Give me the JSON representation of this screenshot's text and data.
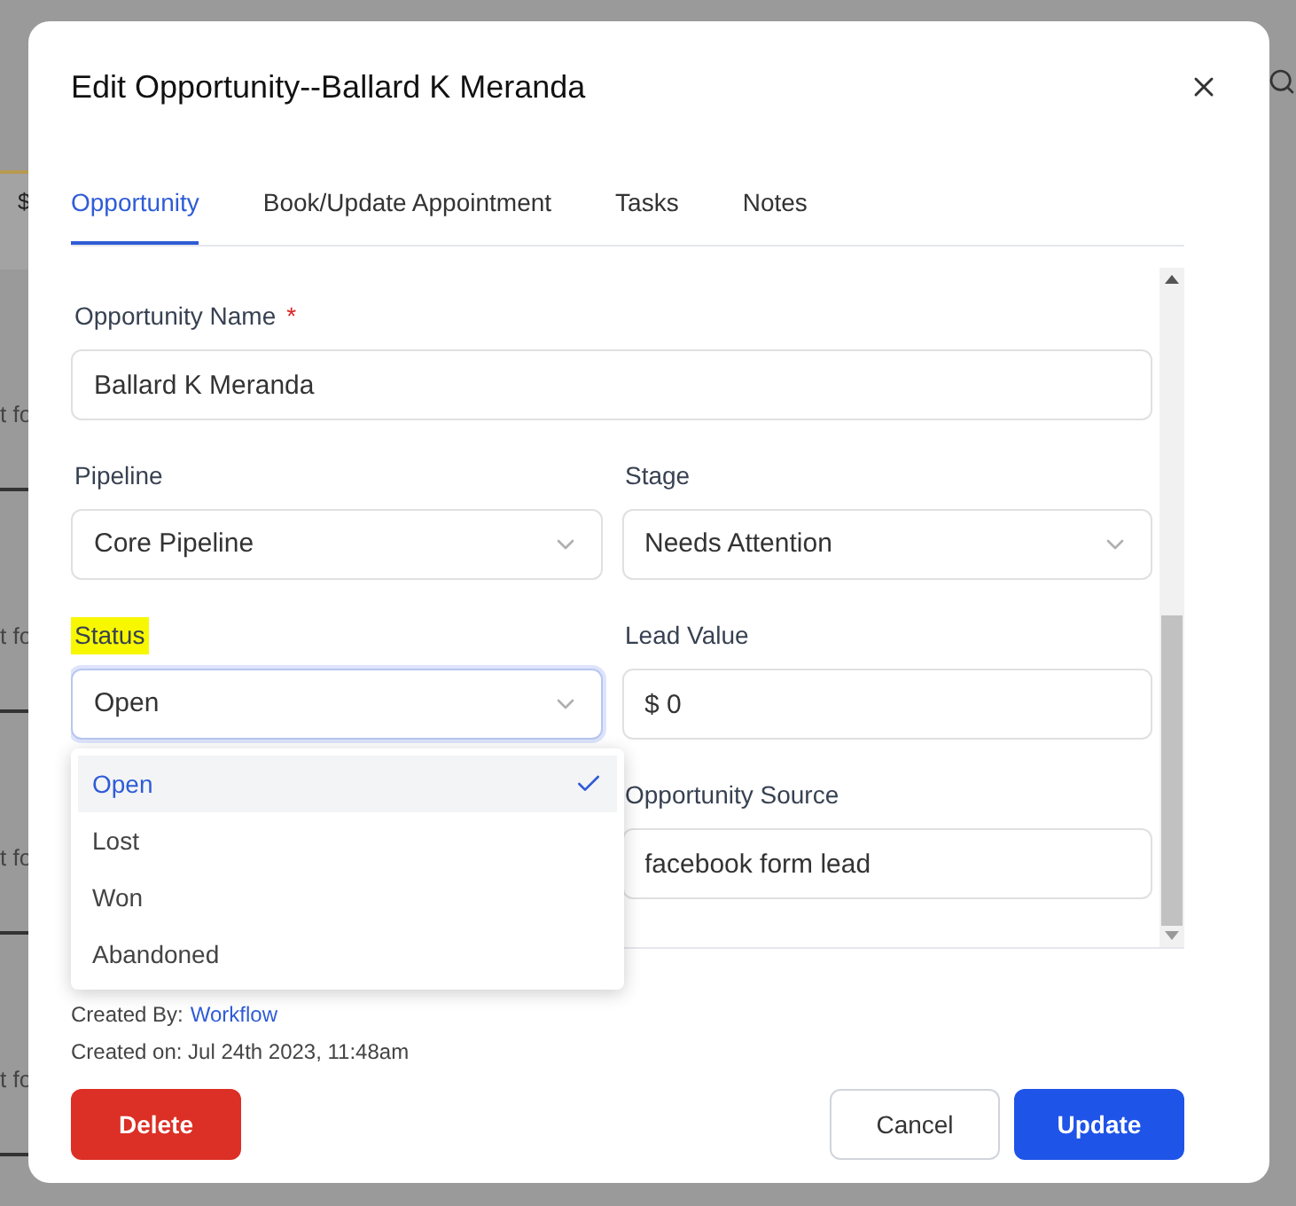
{
  "background": {
    "column_subheader": "$",
    "cards": [
      {
        "subtitle": "t fo"
      },
      {
        "subtitle": "t fo"
      },
      {
        "subtitle": "t fo"
      },
      {
        "subtitle": "t fo"
      }
    ]
  },
  "dialog": {
    "title": "Edit Opportunity--Ballard K Meranda",
    "tabs": [
      {
        "label": "Opportunity",
        "selected": true
      },
      {
        "label": "Book/Update Appointment",
        "selected": false
      },
      {
        "label": "Tasks",
        "selected": false
      },
      {
        "label": "Notes",
        "selected": false
      }
    ],
    "required_mark": "*",
    "fields": [
      {
        "label": "Opportunity Name",
        "required": true,
        "kind": "text",
        "value": "Ballard K Meranda",
        "highlighted": false,
        "focused": false
      },
      {
        "label": "Pipeline",
        "required": false,
        "kind": "select",
        "value": "Core Pipeline",
        "highlighted": false,
        "focused": false
      },
      {
        "label": "Stage",
        "required": false,
        "kind": "select",
        "value": "Needs Attention",
        "highlighted": false,
        "focused": false
      },
      {
        "label": "Status",
        "required": false,
        "kind": "select",
        "value": "Open",
        "highlighted": true,
        "focused": true
      },
      {
        "label": "Lead Value",
        "required": false,
        "kind": "text",
        "value": "$ 0",
        "highlighted": false,
        "focused": false
      },
      {
        "label": "Opportunity Source",
        "required": false,
        "kind": "text",
        "value": "facebook form lead",
        "highlighted": false,
        "focused": false
      }
    ],
    "status_options": [
      {
        "label": "Open",
        "selected": true
      },
      {
        "label": "Lost",
        "selected": false
      },
      {
        "label": "Won",
        "selected": false
      },
      {
        "label": "Abandoned",
        "selected": false
      }
    ],
    "created_by_label": "Created By:",
    "created_by": "Workflow",
    "created_on": "Created on: Jul 24th 2023, 11:48am",
    "buttons": {
      "delete": "Delete",
      "cancel": "Cancel",
      "update": "Update"
    }
  }
}
